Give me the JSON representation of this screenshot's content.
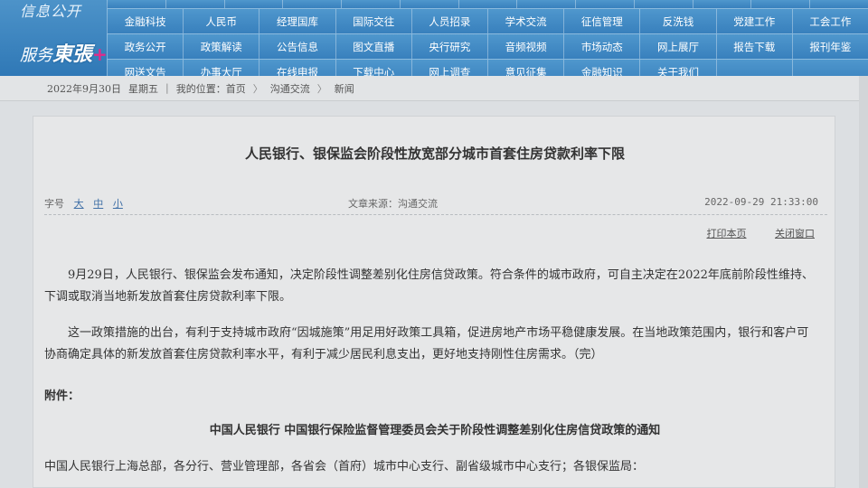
{
  "brand": {
    "top_label": "信息公开",
    "main_prefix": "服务",
    "main_logo": "東張",
    "main_plus": "+"
  },
  "nav": {
    "top_row": [
      "",
      "",
      "",
      "",
      "",
      "",
      "",
      "",
      "",
      "",
      "",
      "",
      ""
    ],
    "rows": [
      [
        "金融科技",
        "人民币",
        "经理国库",
        "国际交往",
        "人员招录",
        "学术交流",
        "征信管理",
        "反洗钱",
        "党建工作",
        "工会工作"
      ],
      [
        "政务公开",
        "政策解读",
        "公告信息",
        "图文直播",
        "央行研究",
        "音频视频",
        "市场动态",
        "网上展厅",
        "报告下载",
        "报刊年鉴"
      ],
      [
        "网送文告",
        "办事大厅",
        "在线申报",
        "下载中心",
        "网上调查",
        "意见征集",
        "金融知识",
        "关于我们",
        "",
        ""
      ]
    ]
  },
  "breadcrumb": {
    "date": "2022年9月30日",
    "weekday": "星期五",
    "location_label": "我的位置：首页",
    "level1": "沟通交流",
    "level2": "新闻",
    "sep": "〉"
  },
  "article": {
    "title": "人民银行、银保监会阶段性放宽部分城市首套住房贷款利率下限",
    "fontsize_label": "字号",
    "fontsize_large": "大",
    "fontsize_medium": "中",
    "fontsize_small": "小",
    "source": "文章来源：沟通交流",
    "datetime": "2022-09-29  21:33:00",
    "print_label": "打印本页",
    "close_label": "关闭窗口",
    "para1": "9月29日，人民银行、银保监会发布通知，决定阶段性调整差别化住房信贷政策。符合条件的城市政府，可自主决定在2022年底前阶段性维持、下调或取消当地新发放首套住房贷款利率下限。",
    "para2": "这一政策措施的出台，有利于支持城市政府“因城施策”用足用好政策工具箱，促进房地产市场平稳健康发展。在当地政策范围内，银行和客户可协商确定具体的新发放首套住房贷款利率水平，有利于减少居民利息支出，更好地支持刚性住房需求。（完）",
    "attachment_label": "附件：",
    "notice_title": "中国人民银行  中国银行保险监督管理委员会关于阶段性调整差别化住房信贷政策的通知",
    "addressee": "中国人民银行上海总部，各分行、营业管理部，各省会（首府）城市中心支行、副省级城市中心支行；各银保监局："
  },
  "colors": {
    "nav_blue": "#3880bd",
    "background": "#dcdfe2",
    "accent_pink": "#e12a8a"
  }
}
